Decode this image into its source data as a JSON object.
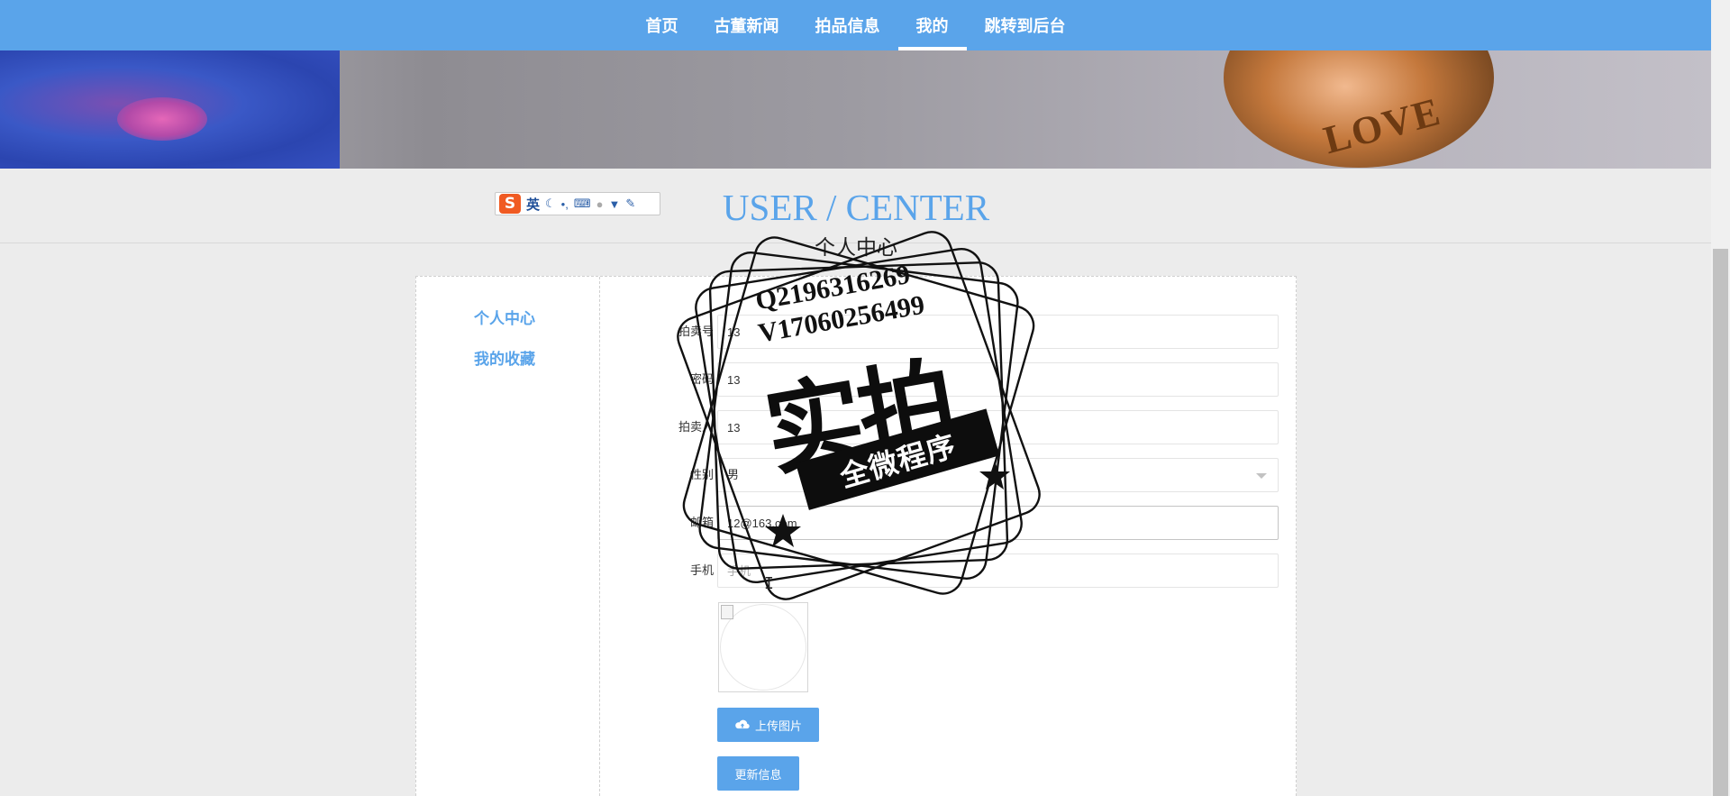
{
  "nav": {
    "items": [
      {
        "label": "首页",
        "active": false
      },
      {
        "label": "古董新闻",
        "active": false
      },
      {
        "label": "拍品信息",
        "active": false
      },
      {
        "label": "我的",
        "active": true
      },
      {
        "label": "跳转到后台",
        "active": false
      }
    ]
  },
  "banner": {
    "medal_text": "LOVE"
  },
  "ime_toolbar": {
    "logo": "S",
    "language": "英",
    "tools": [
      "moon-icon",
      "punctuation-icon",
      "keyboard-icon",
      "user-icon",
      "skin-icon",
      "wrench-icon"
    ]
  },
  "header": {
    "title": "USER / CENTER",
    "subtitle": "个人中心"
  },
  "sidebar": {
    "items": [
      {
        "label": "个人中心"
      },
      {
        "label": "我的收藏"
      }
    ]
  },
  "form": {
    "fields": [
      {
        "label": "拍卖号",
        "value": "13",
        "placeholder": ""
      },
      {
        "label": "密码",
        "value": "13",
        "placeholder": ""
      },
      {
        "label": "拍卖人",
        "value": "13",
        "placeholder": ""
      },
      {
        "label": "性别",
        "value": "男",
        "type": "select"
      },
      {
        "label": "邮箱",
        "value": "12@163.com",
        "placeholder": ""
      },
      {
        "label": "手机",
        "value": "",
        "placeholder": "手机"
      }
    ],
    "upload_button": "上传图片",
    "update_button": "更新信息"
  },
  "watermark": {
    "line1": "Q2196316269",
    "line2": "V17060256499",
    "main": "实拍",
    "ribbon": "全微程序"
  },
  "colors": {
    "accent": "#5aa4ea",
    "page_background": "#ececec"
  }
}
